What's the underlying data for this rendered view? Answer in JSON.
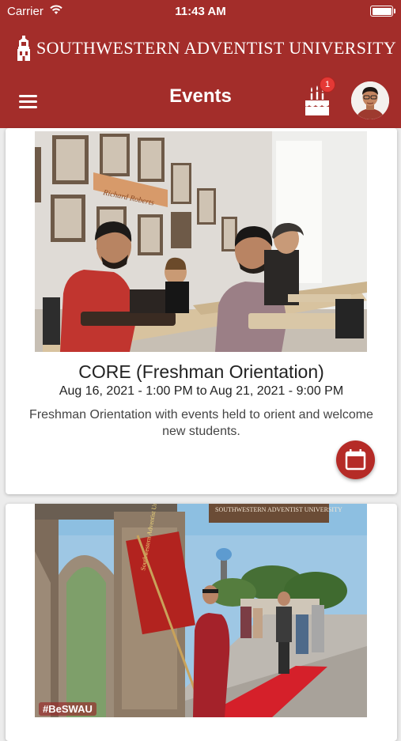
{
  "status_bar": {
    "carrier": "Carrier",
    "time": "11:43 AM"
  },
  "header": {
    "brand": "SOUTHWESTERN ADVENTIST UNIVERSITY",
    "title": "Events",
    "notification_count": "1"
  },
  "events": [
    {
      "title": "CORE (Freshman Orientation)",
      "date": "Aug 16, 2021 - 1:00 PM to Aug 21, 2021 - 9:00 PM",
      "description": "Freshman Orientation with events held to orient and welcome new students.",
      "image_sign": "Richard Roberts",
      "icon": "calendar-icon"
    },
    {
      "banner_sign": "SOUTHWESTERN ADVENTIST UNIVERSITY",
      "flag_text": "Southwestern Adventist University",
      "hashtag": "#BeSWAU"
    }
  ],
  "colors": {
    "brand_red": "#a32d2a",
    "fab_red": "#b52b27",
    "badge_red": "#e53935"
  }
}
